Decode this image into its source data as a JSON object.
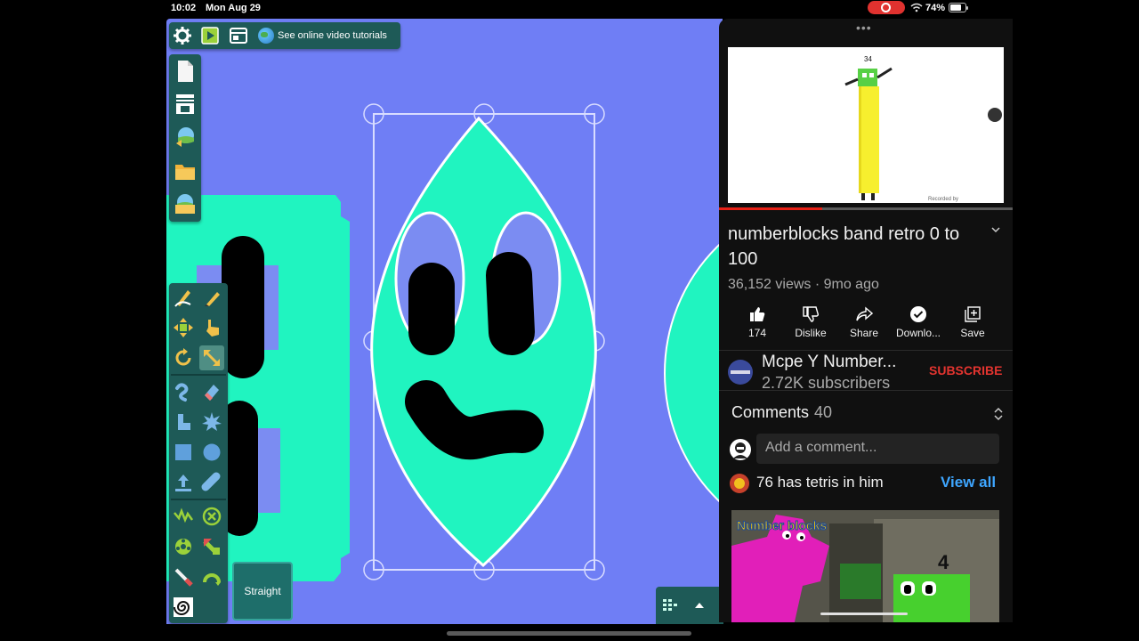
{
  "status_bar": {
    "time": "10:02",
    "date": "Mon Aug 29",
    "battery": "74%"
  },
  "toolbar": {
    "tutorial_link": "See online video tutorials",
    "icons": [
      "gear-icon",
      "play-icon",
      "window-icon",
      "globe-icon"
    ]
  },
  "file_toolbar": {
    "icons": [
      "new-file-icon",
      "layers-icon",
      "import-image-icon",
      "folder-icon",
      "save-icon"
    ]
  },
  "tool_palette": {
    "icons": [
      "pencil-shape-icon",
      "pen-icon",
      "move-icon",
      "hand-pointer-icon",
      "rotate-icon",
      "resize-icon",
      "curve-icon",
      "eraser-icon",
      "boot-icon",
      "star-burst-icon",
      "square-icon",
      "circle-icon",
      "upload-icon",
      "capsule-icon",
      "zigzag-icon",
      "close-circle-icon",
      "gear-wheel-icon",
      "arrow-shape-icon",
      "brush-icon",
      "arc-icon",
      "spiral-icon"
    ],
    "selected_tool": "resize-icon",
    "mode_button": "Straight"
  },
  "colors": {
    "canvas_bg": "#6f7ef5",
    "shape_fill": "#20f4c0",
    "toolbar_bg": "#1e5a57",
    "youtube_bg": "#101010",
    "subscribe_red": "#e3342f",
    "link_blue": "#3ea6ff"
  },
  "youtube": {
    "video_title": "numberblocks band retro 0 to 100",
    "video_meta": "36,152 views · 9mo ago",
    "progress": 0.35,
    "actions": [
      {
        "icon": "thumbs-up-icon",
        "label": "174"
      },
      {
        "icon": "thumbs-down-icon",
        "label": "Dislike"
      },
      {
        "icon": "share-icon",
        "label": "Share"
      },
      {
        "icon": "download-icon",
        "label": "Downlo..."
      },
      {
        "icon": "add-playlist-icon",
        "label": "Save"
      }
    ],
    "channel": {
      "name": "Mcpe Y Number...",
      "subscribers": "2.72K subscribers",
      "subscribe_label": "SUBSCRIBE"
    },
    "comments": {
      "label": "Comments",
      "count": "40",
      "add_placeholder": "Add a comment...",
      "top_comment": "76 has tetris in him",
      "view_all": "View all"
    },
    "video_badge": "34",
    "thumbnail_text": {
      "logo": "Number blocks",
      "number": "4"
    },
    "watermark": "Recorded by"
  }
}
